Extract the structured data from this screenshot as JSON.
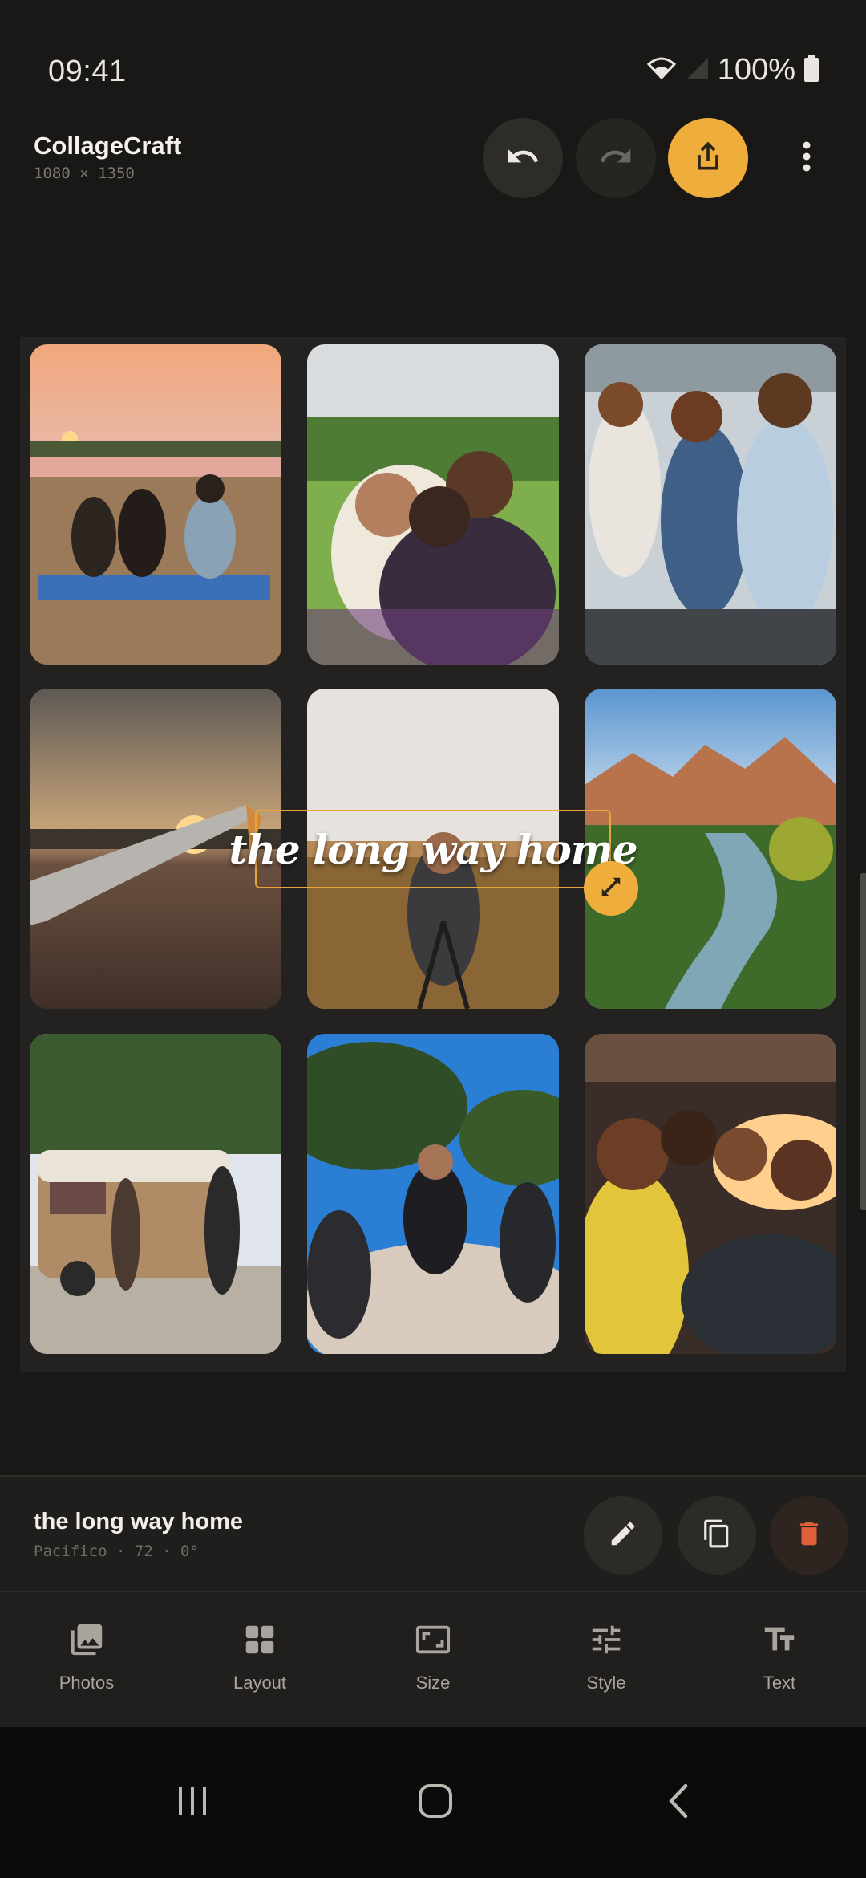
{
  "status_bar": {
    "time": "09:41",
    "battery": "100%"
  },
  "app": {
    "title": "CollageCraft",
    "dimensions": "1080 × 1350"
  },
  "toolbar": {
    "undo_icon": "undo-icon",
    "redo_icon": "redo-icon",
    "share_icon": "share-icon",
    "more_icon": "more-vert-icon"
  },
  "canvas": {
    "photos": [
      {
        "subject": "friends on beach at sunset"
      },
      {
        "subject": "couple embracing in meadow"
      },
      {
        "subject": "friends sitting on boat"
      },
      {
        "subject": "airplane wing at sunset"
      },
      {
        "subject": "photographer with tripod in field"
      },
      {
        "subject": "canyon river landscape"
      },
      {
        "subject": "friends by vintage van"
      },
      {
        "subject": "friends on boulders"
      },
      {
        "subject": "friends in car at sunset"
      }
    ],
    "text_overlay": "the long way home"
  },
  "selected_text": {
    "label": "the long way home",
    "meta": "Pacifico · 72 · 0°"
  },
  "tabs": [
    {
      "label": "Photos",
      "icon": "photo-icon"
    },
    {
      "label": "Layout",
      "icon": "grid-icon"
    },
    {
      "label": "Size",
      "icon": "aspect-ratio-icon"
    },
    {
      "label": "Style",
      "icon": "sliders-icon"
    },
    {
      "label": "Text",
      "icon": "text-icon"
    }
  ],
  "colors": {
    "accent": "#efad3c",
    "delete": "#e0603a",
    "background": "#191817"
  }
}
